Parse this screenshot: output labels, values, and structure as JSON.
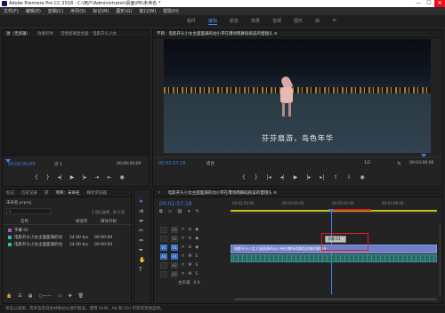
{
  "window": {
    "title": "Adobe Premiere Pro CC 2018 - C:\\用户\\Administrator\\桌面\\PR\\未命名 *",
    "buttons": [
      "—",
      "☐",
      "✕"
    ]
  },
  "menu": [
    "文件(F)",
    "编辑(E)",
    "剪辑(C)",
    "序列(S)",
    "标记(M)",
    "图形(G)",
    "窗口(W)",
    "帮助(H)"
  ],
  "workspaces": [
    "组件",
    "编辑",
    "颜色",
    "效果",
    "音频",
    "图形",
    "库",
    "≫"
  ],
  "workspaces_active": 1,
  "source_panel": {
    "tabs": [
      "源（无剪辑）",
      "效果控件",
      "音频剪辑混合器：电影开头小女"
    ],
    "timecode_left": "00;00;00;00",
    "page": "页 1",
    "timecode_right": "00;00;00;00"
  },
  "program_panel": {
    "title": "节目：电影开头小女主面面满的动小带在爆场两舞蹈很美的慢镜头 ≡",
    "subtitle": "芬芬扇游，岛色年华",
    "timecode_left": "00:02:57:16",
    "fit": "适合",
    "quality": "1/2",
    "timecode_right": "00:03:06:06"
  },
  "project_panel": {
    "tabs": [
      "标记",
      "历史记录",
      "库",
      "项目：未命名",
      "媒体浏览器"
    ],
    "project_file": "未命名.prproj",
    "item_count": "1 项已选择，共 3 项",
    "col_name": "名称",
    "col_rate": "帧速率",
    "col_start": "媒体开始",
    "items": [
      {
        "color": "#a25cc8",
        "name": "字幕 01",
        "rate": "",
        "start": ""
      },
      {
        "color": "#2fb7a8",
        "name": "电影开头小女主面面满的动",
        "rate": "24.00 fps",
        "start": "00:00:00"
      },
      {
        "color": "#2fb7a8",
        "name": "电影开头小女主面面满的动",
        "rate": "24.00 fps",
        "start": "00:00:00"
      }
    ]
  },
  "timeline": {
    "title": "电影开头小女主面面满的动小带在爆场两舞蹈很美的慢镜头 ≡",
    "timecode": "00:02:57:16",
    "ruler": [
      "00:02:56:00",
      "00:03:00:00",
      "00:03:04:00",
      "00:03:08:00"
    ],
    "tracks": [
      "V3",
      "V2",
      "V1",
      "A1",
      "A2",
      "A3"
    ],
    "master": "主声道",
    "master_val": "0.0",
    "clip_label": "电影开头小女主面面满的动小带在爆场两舞蹈很美的慢镜头",
    "title_clip": "字幕 01"
  },
  "status": "单击以选择，或单击空白处并拖动以进行框选。使用 Shift、Alt 和 Ctrl 可获得其他选项。",
  "colors": {
    "accent": "#3b83ec",
    "highlight": "#e02020",
    "clip": "#6f7fc8",
    "audio": "#2a6a66"
  }
}
